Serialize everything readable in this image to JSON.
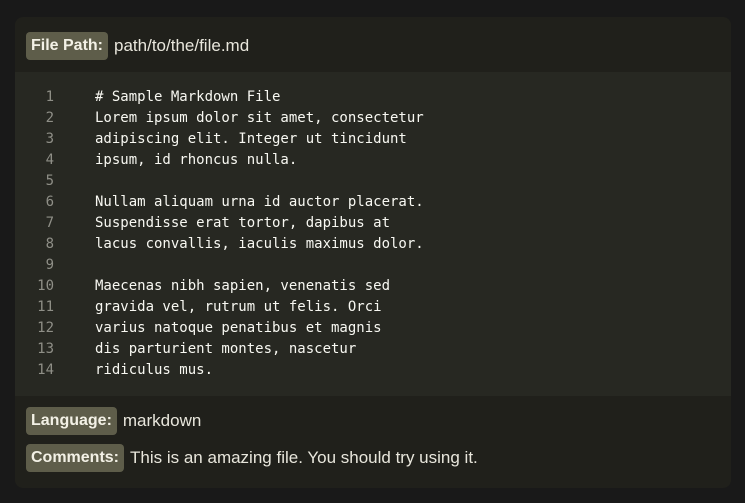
{
  "file_path": {
    "label": "File Path:",
    "value": "path/to/the/file.md"
  },
  "code": {
    "lines": [
      {
        "num": "1",
        "text": "# Sample Markdown File"
      },
      {
        "num": "2",
        "text": "Lorem ipsum dolor sit amet, consectetur"
      },
      {
        "num": "3",
        "text": "adipiscing elit. Integer ut tincidunt"
      },
      {
        "num": "4",
        "text": "ipsum, id rhoncus nulla."
      },
      {
        "num": "5",
        "text": ""
      },
      {
        "num": "6",
        "text": "Nullam aliquam urna id auctor placerat."
      },
      {
        "num": "7",
        "text": "Suspendisse erat tortor, dapibus at"
      },
      {
        "num": "8",
        "text": "lacus convallis, iaculis maximus dolor."
      },
      {
        "num": "9",
        "text": ""
      },
      {
        "num": "10",
        "text": "Maecenas nibh sapien, venenatis sed"
      },
      {
        "num": "11",
        "text": "gravida vel, rutrum ut felis. Orci"
      },
      {
        "num": "12",
        "text": "varius natoque penatibus et magnis"
      },
      {
        "num": "13",
        "text": "dis parturient montes, nascetur"
      },
      {
        "num": "14",
        "text": "ridiculus mus."
      }
    ]
  },
  "language": {
    "label": "Language:",
    "value": "markdown"
  },
  "comments": {
    "label": "Comments:",
    "value": "This is an amazing file. You should try using it."
  },
  "colors": {
    "page_background": "#191919",
    "card_background": "#20201b",
    "code_background": "#272822",
    "badge_background": "#5e5d4a",
    "line_number": "#8f8f87",
    "code_text": "#f8f8f2"
  }
}
